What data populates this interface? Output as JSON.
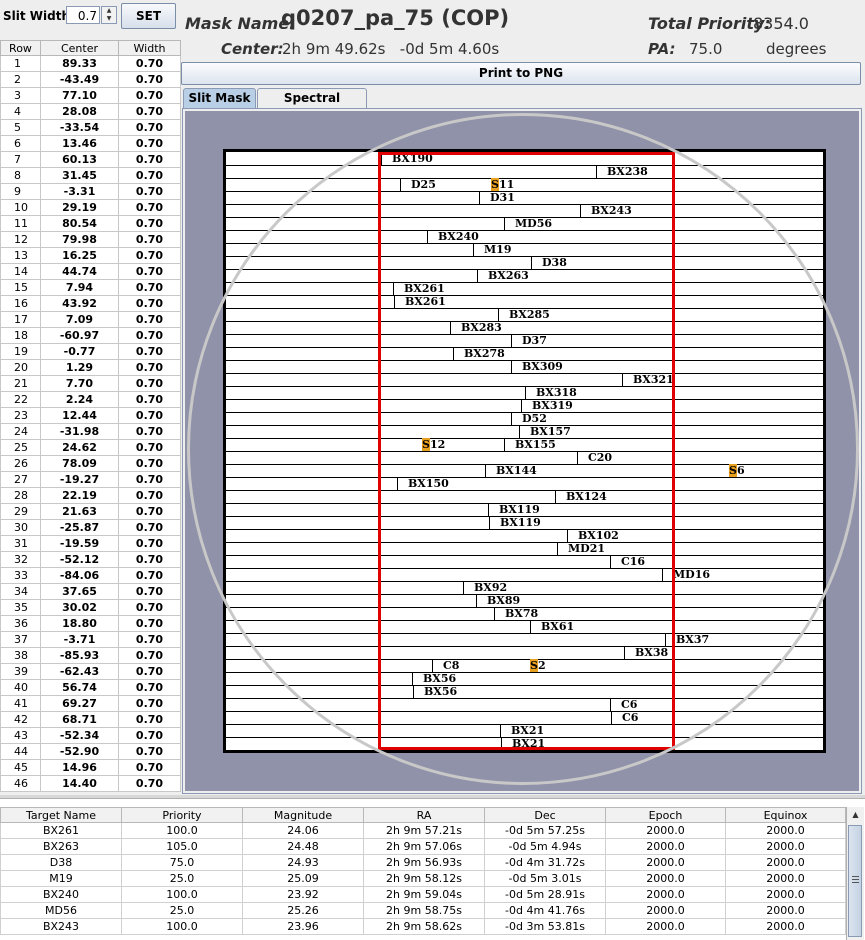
{
  "slit_width": {
    "label": "Slit Width:",
    "value": "0.7",
    "set_label": "SET"
  },
  "row_table": {
    "headers": [
      "Row",
      "Center",
      "Width"
    ],
    "rows": [
      [
        "1",
        "89.33",
        "0.70"
      ],
      [
        "2",
        "-43.49",
        "0.70"
      ],
      [
        "3",
        "77.10",
        "0.70"
      ],
      [
        "4",
        "28.08",
        "0.70"
      ],
      [
        "5",
        "-33.54",
        "0.70"
      ],
      [
        "6",
        "13.46",
        "0.70"
      ],
      [
        "7",
        "60.13",
        "0.70"
      ],
      [
        "8",
        "31.45",
        "0.70"
      ],
      [
        "9",
        "-3.31",
        "0.70"
      ],
      [
        "10",
        "29.19",
        "0.70"
      ],
      [
        "11",
        "80.54",
        "0.70"
      ],
      [
        "12",
        "79.98",
        "0.70"
      ],
      [
        "13",
        "16.25",
        "0.70"
      ],
      [
        "14",
        "44.74",
        "0.70"
      ],
      [
        "15",
        "7.94",
        "0.70"
      ],
      [
        "16",
        "43.92",
        "0.70"
      ],
      [
        "17",
        "7.09",
        "0.70"
      ],
      [
        "18",
        "-60.97",
        "0.70"
      ],
      [
        "19",
        "-0.77",
        "0.70"
      ],
      [
        "20",
        "1.29",
        "0.70"
      ],
      [
        "21",
        "7.70",
        "0.70"
      ],
      [
        "22",
        "2.24",
        "0.70"
      ],
      [
        "23",
        "12.44",
        "0.70"
      ],
      [
        "24",
        "-31.98",
        "0.70"
      ],
      [
        "25",
        "24.62",
        "0.70"
      ],
      [
        "26",
        "78.09",
        "0.70"
      ],
      [
        "27",
        "-19.27",
        "0.70"
      ],
      [
        "28",
        "22.19",
        "0.70"
      ],
      [
        "29",
        "21.63",
        "0.70"
      ],
      [
        "30",
        "-25.87",
        "0.70"
      ],
      [
        "31",
        "-19.59",
        "0.70"
      ],
      [
        "32",
        "-52.12",
        "0.70"
      ],
      [
        "33",
        "-84.06",
        "0.70"
      ],
      [
        "34",
        "37.65",
        "0.70"
      ],
      [
        "35",
        "30.02",
        "0.70"
      ],
      [
        "36",
        "18.80",
        "0.70"
      ],
      [
        "37",
        "-3.71",
        "0.70"
      ],
      [
        "38",
        "-85.93",
        "0.70"
      ],
      [
        "39",
        "-62.43",
        "0.70"
      ],
      [
        "40",
        "56.74",
        "0.70"
      ],
      [
        "41",
        "69.27",
        "0.70"
      ],
      [
        "42",
        "68.71",
        "0.70"
      ],
      [
        "43",
        "-52.34",
        "0.70"
      ],
      [
        "44",
        "-52.90",
        "0.70"
      ],
      [
        "45",
        "14.96",
        "0.70"
      ],
      [
        "46",
        "14.40",
        "0.70"
      ]
    ]
  },
  "header": {
    "mask_name_label": "Mask Name:",
    "mask_name": "q0207_pa_75 (COP)",
    "center_label": "Center:",
    "center_value": "2h 9m 49.62s   -0d 5m 4.60s",
    "total_priority_label": "Total Priority:",
    "total_priority": "8354.0",
    "pa_label": "PA:",
    "pa_value": "75.0",
    "pa_unit": "degrees"
  },
  "print_button": "Print to PNG",
  "tabs": [
    {
      "label": "Slit Mask",
      "active": true
    },
    {
      "label": "Spectral Format",
      "active": false
    }
  ],
  "mask_targets": [
    {
      "row": 1,
      "label": "BX190",
      "tick": 155
    },
    {
      "row": 2,
      "label": "BX238",
      "tick": 370
    },
    {
      "row": 3,
      "label": "D25",
      "tick": 174
    },
    {
      "row": 3,
      "label": "S11",
      "tick": null,
      "highlight": "S"
    },
    {
      "row": 4,
      "label": "D31",
      "tick": 253
    },
    {
      "row": 5,
      "label": "BX243",
      "tick": 354
    },
    {
      "row": 6,
      "label": "MD56",
      "tick": 278
    },
    {
      "row": 7,
      "label": "BX240",
      "tick": 201
    },
    {
      "row": 8,
      "label": "M19",
      "tick": 247
    },
    {
      "row": 9,
      "label": "D38",
      "tick": 305
    },
    {
      "row": 10,
      "label": "BX263",
      "tick": 251
    },
    {
      "row": 11,
      "label": "BX261",
      "tick": 167
    },
    {
      "row": 12,
      "label": "BX261",
      "tick": 168
    },
    {
      "row": 13,
      "label": "BX285",
      "tick": 272
    },
    {
      "row": 14,
      "label": "BX283",
      "tick": 224
    },
    {
      "row": 15,
      "label": "D37",
      "tick": 285
    },
    {
      "row": 16,
      "label": "BX278",
      "tick": 227
    },
    {
      "row": 17,
      "label": "BX309",
      "tick": 285
    },
    {
      "row": 18,
      "label": "BX321",
      "tick": 396
    },
    {
      "row": 19,
      "label": "BX318",
      "tick": 299
    },
    {
      "row": 20,
      "label": "BX319",
      "tick": 295
    },
    {
      "row": 21,
      "label": "D52",
      "tick": 285
    },
    {
      "row": 22,
      "label": "BX157",
      "tick": 293
    },
    {
      "row": 23,
      "label": "S12",
      "tick": null,
      "highlight": "S"
    },
    {
      "row": 23,
      "label": "BX155",
      "tick": 278
    },
    {
      "row": 24,
      "label": "C20",
      "tick": 351
    },
    {
      "row": 25,
      "label": "S6",
      "tick": null,
      "highlight": "S"
    },
    {
      "row": 25,
      "label": "BX144",
      "tick": 259
    },
    {
      "row": 26,
      "label": "BX150",
      "tick": 171
    },
    {
      "row": 27,
      "label": "BX124",
      "tick": 329
    },
    {
      "row": 28,
      "label": "BX119",
      "tick": 262
    },
    {
      "row": 29,
      "label": "BX119",
      "tick": 263
    },
    {
      "row": 30,
      "label": "BX102",
      "tick": 341
    },
    {
      "row": 31,
      "label": "MD21",
      "tick": 331
    },
    {
      "row": 32,
      "label": "C16",
      "tick": 384
    },
    {
      "row": 33,
      "label": "MD16",
      "tick": 436
    },
    {
      "row": 34,
      "label": "BX92",
      "tick": 237
    },
    {
      "row": 35,
      "label": "BX89",
      "tick": 250
    },
    {
      "row": 36,
      "label": "BX78",
      "tick": 268
    },
    {
      "row": 37,
      "label": "BX61",
      "tick": 304
    },
    {
      "row": 38,
      "label": "BX37",
      "tick": 439
    },
    {
      "row": 39,
      "label": "BX38",
      "tick": 398
    },
    {
      "row": 40,
      "label": "C8",
      "tick": 206
    },
    {
      "row": 40,
      "label": "S2",
      "tick": null,
      "highlight": "S"
    },
    {
      "row": 41,
      "label": "BX56",
      "tick": 186
    },
    {
      "row": 42,
      "label": "BX56",
      "tick": 187
    },
    {
      "row": 43,
      "label": "C6",
      "tick": 384
    },
    {
      "row": 44,
      "label": "C6",
      "tick": 385
    },
    {
      "row": 45,
      "label": "BX21",
      "tick": 274
    },
    {
      "row": 46,
      "label": "BX21",
      "tick": 275
    }
  ],
  "target_table": {
    "headers": [
      "Target Name",
      "Priority",
      "Magnitude",
      "RA",
      "Dec",
      "Epoch",
      "Equinox"
    ],
    "rows": [
      [
        "BX261",
        "100.0",
        "24.06",
        "2h 9m 57.21s",
        "-0d 5m 57.25s",
        "2000.0",
        "2000.0"
      ],
      [
        "BX263",
        "105.0",
        "24.48",
        "2h 9m 57.06s",
        "-0d 5m 4.94s",
        "2000.0",
        "2000.0"
      ],
      [
        "D38",
        "75.0",
        "24.93",
        "2h 9m 56.93s",
        "-0d 4m 31.72s",
        "2000.0",
        "2000.0"
      ],
      [
        "M19",
        "25.0",
        "25.09",
        "2h 9m 58.12s",
        "-0d 5m 3.01s",
        "2000.0",
        "2000.0"
      ],
      [
        "BX240",
        "100.0",
        "23.92",
        "2h 9m 59.04s",
        "-0d 5m 28.91s",
        "2000.0",
        "2000.0"
      ],
      [
        "MD56",
        "25.0",
        "25.26",
        "2h 9m 58.75s",
        "-0d 4m 41.76s",
        "2000.0",
        "2000.0"
      ],
      [
        "BX243",
        "100.0",
        "23.96",
        "2h 9m 58.62s",
        "-0d 3m 53.81s",
        "2000.0",
        "2000.0"
      ]
    ]
  }
}
